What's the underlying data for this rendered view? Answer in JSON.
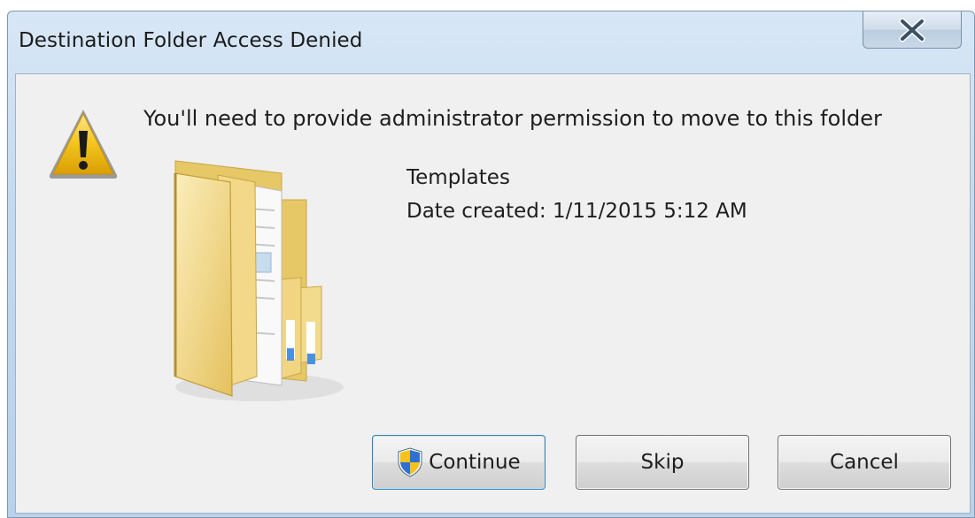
{
  "window": {
    "title": "Destination Folder Access Denied",
    "close_symbol": "X"
  },
  "message": "You'll need to provide administrator permission to move to this folder",
  "item": {
    "name": "Templates",
    "date_created": "Date created: 1/11/2015 5:12 AM"
  },
  "buttons": {
    "continue_label": "Continue",
    "skip_label": "Skip",
    "cancel_label": "Cancel"
  },
  "icons": {
    "warning": "warning-icon",
    "folder": "folder-icon",
    "shield": "uac-shield-icon",
    "close": "close-icon"
  },
  "colors": {
    "titlebar": "#c4d9ee",
    "client_bg": "#f0f0f0",
    "warning_yellow": "#f2c41c",
    "folder_yellow": "#f3d98a"
  }
}
